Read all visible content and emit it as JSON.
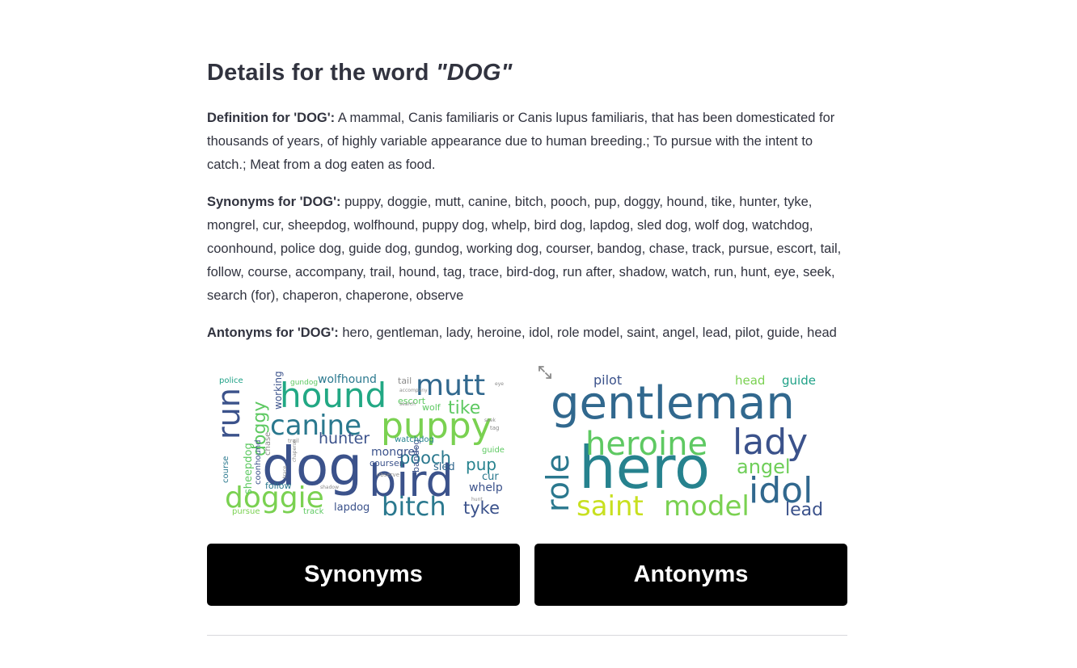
{
  "title": {
    "prefix": "Details for the word ",
    "word": "\"DOG\""
  },
  "definition": {
    "label": "Definition for 'DOG':",
    "text": " A mammal, Canis familiaris or Canis lupus familiaris, that has been domesticated for thousands of years, of highly variable appearance due to human breeding.; To pursue with the intent to catch.; Meat from a dog eaten as food."
  },
  "synonyms": {
    "label": "Synonyms for 'DOG':",
    "text": " puppy, doggie, mutt, canine, bitch, pooch, pup, doggy, hound, tike, hunter, tyke, mongrel, cur, sheepdog, wolfhound, puppy dog, whelp, bird dog, lapdog, sled dog, wolf dog, watchdog, coonhound, police dog, guide dog, gundog, working dog, courser, bandog, chase, track, pursue, escort, tail, follow, course, accompany, trail, hound, tag, trace, bird-dog, run after, shadow, watch, run, hunt, eye, seek, search (for), chaperon, chaperone, observe"
  },
  "antonyms": {
    "label": "Antonyms for 'DOG':",
    "text": " hero, gentleman, lady, heroine, idol, role model, saint, angel, lead, pilot, guide, head"
  },
  "synonym_cloud": {
    "words": [
      "dog",
      "bird",
      "puppy",
      "hound",
      "mutt",
      "canine",
      "run",
      "doggie",
      "bitch",
      "doggy",
      "tike",
      "hunter",
      "pooch",
      "tyke",
      "pup",
      "mongrel",
      "wolfhound",
      "escort",
      "wolf",
      "tail",
      "police",
      "gundog",
      "working",
      "chase",
      "sheepdog",
      "coonhound",
      "course",
      "follow",
      "pursue",
      "track",
      "lapdog",
      "whelp",
      "cur",
      "sled",
      "courser",
      "bandog",
      "watchdog",
      "guide",
      "trail",
      "observe",
      "shadow",
      "search",
      "accompany",
      "hunt",
      "tag",
      "eye",
      "seek",
      "chaperon",
      "trace"
    ]
  },
  "antonym_cloud": {
    "words": [
      "gentleman",
      "hero",
      "lady",
      "heroine",
      "role",
      "idol",
      "saint",
      "model",
      "angel",
      "lead",
      "pilot",
      "head",
      "guide"
    ]
  },
  "buttons": {
    "synonyms": "Synonyms",
    "antonyms": "Antonyms"
  },
  "colors": {
    "text": "#31333f",
    "button_bg": "#000000",
    "button_text": "#ffffff",
    "divider": "#d8d8dd"
  }
}
